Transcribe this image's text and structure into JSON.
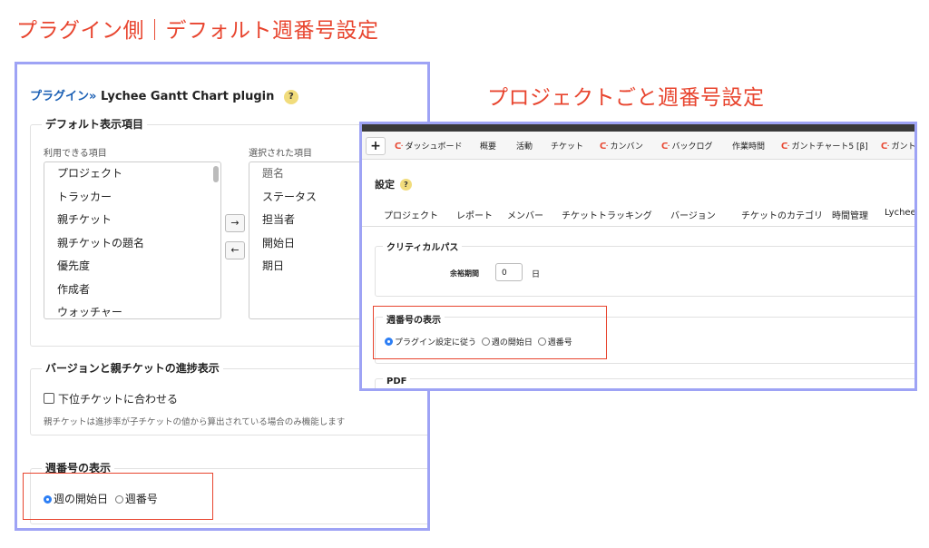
{
  "captions": {
    "plugin_side": "プラグイン側｜デフォルト週番号設定",
    "project_side": "プロジェクトごと週番号設定"
  },
  "plugin_page": {
    "breadcrumb_prefix": "プラグイン»",
    "title": "Lychee Gantt Chart plugin",
    "help": "?",
    "default_display": {
      "legend": "デフォルト表示項目",
      "available_label": "利用できる項目",
      "selected_label": "選択された項目",
      "available_items": [
        "プロジェクト",
        "トラッカー",
        "親チケット",
        "親チケットの題名",
        "優先度",
        "作成者",
        "ウォッチャー"
      ],
      "selected_items": [
        "題名",
        "ステータス",
        "担当者",
        "開始日",
        "期日"
      ],
      "add_arrow": "→",
      "remove_arrow": "←"
    },
    "progress": {
      "legend": "バージョンと親チケットの進捗表示",
      "checkbox_label": "下位チケットに合わせる",
      "note": "親チケットは進捗率が子チケットの値から算出されている場合のみ機能します"
    },
    "week_number": {
      "legend": "週番号の表示",
      "options": [
        "週の開始日",
        "週番号"
      ],
      "selected_index": 0
    }
  },
  "project_page": {
    "menu": {
      "plus": "+",
      "items": [
        "ダッシュボード",
        "概要",
        "活動",
        "チケット",
        "カンバン",
        "バックログ",
        "作業時間",
        "ガントチャート5 [β]",
        "ガント"
      ]
    },
    "settings_title": "設定",
    "help": "?",
    "tabs": [
      "プロジェクト",
      "レポート",
      "メンバー",
      "チケットトラッキング",
      "バージョン",
      "チケットのカテゴリ",
      "時間管理",
      "Lychee"
    ],
    "critical_path": {
      "legend": "クリティカルパス",
      "slack_label": "余裕期間",
      "slack_value": "0",
      "unit": "日"
    },
    "week_number": {
      "legend": "週番号の表示",
      "options": [
        "プラグイン設定に従う",
        "週の開始日",
        "週番号"
      ],
      "selected_index": 0
    },
    "pdf_legend": "PDF"
  }
}
